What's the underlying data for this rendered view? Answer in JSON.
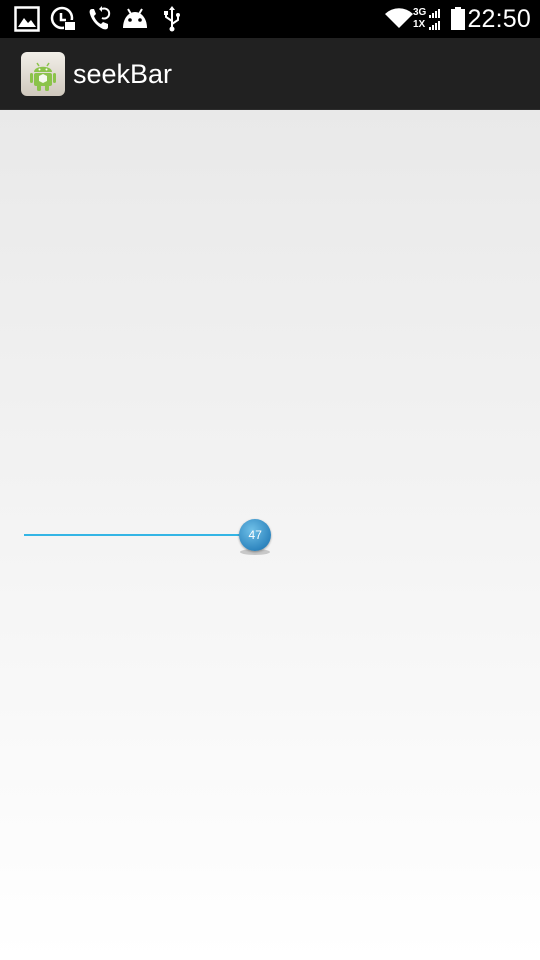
{
  "status_bar": {
    "time": "22:50",
    "icons": [
      "image-icon",
      "data-saver-icon",
      "call-forwarding-icon",
      "android-debug-icon",
      "usb-icon",
      "wifi-icon",
      "network-3g-1x-icon",
      "battery-icon"
    ],
    "network_labels": {
      "top": "3G",
      "bottom": "1X"
    }
  },
  "action_bar": {
    "title": "seekBar",
    "icon": "android-app-icon"
  },
  "seekbar": {
    "value": 47,
    "label": "47",
    "max": 100,
    "progress_color": "#33b5e5",
    "thumb_color": "#2f86bf"
  }
}
